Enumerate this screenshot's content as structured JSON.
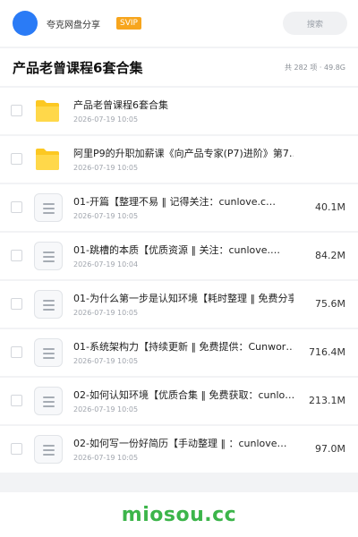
{
  "header": {
    "user_name": "夸克网盘分享",
    "badge": "SVIP",
    "search_label": "搜索"
  },
  "title_bar": {
    "title": "产品老曾课程6套合集",
    "summary": "共 282 项 · 49.8G"
  },
  "files": [
    {
      "name": "产品老曾课程6套合集",
      "date": "2026-07-19 10:05",
      "size": "",
      "type": "folder"
    },
    {
      "name": "阿里P9的升职加薪课《向产品专家(P7)进阶》第7…",
      "date": "2026-07-19 10:05",
      "size": "",
      "type": "folder"
    },
    {
      "name": "01-开篇【整理不易 ‖ 记得关注：cunlove.c…",
      "date": "2026-07-19 10:05",
      "size": "40.1M",
      "type": "file"
    },
    {
      "name": "01-跳槽的本质【优质资源 ‖ 关注：cunlove.…",
      "date": "2026-07-19 10:04",
      "size": "84.2M",
      "type": "file"
    },
    {
      "name": "01-为什么第一步是认知环境【耗时整理 ‖ 免费分享：…",
      "date": "2026-07-19 10:05",
      "size": "75.6M",
      "type": "file"
    },
    {
      "name": "01-系统架构力【持续更新 ‖ 免费提供：Cunwor…",
      "date": "2026-07-19 10:05",
      "size": "716.4M",
      "type": "file"
    },
    {
      "name": "02-如何认知环境【优质合集 ‖ 免费获取：cunlo…",
      "date": "2026-07-19 10:05",
      "size": "213.1M",
      "type": "file"
    },
    {
      "name": "02-如何写一份好简历【手动整理 ‖ ：cunlove…",
      "date": "2026-07-19 10:05",
      "size": "97.0M",
      "type": "file"
    }
  ],
  "watermark": "miosou.cc",
  "colors": {
    "avatar": "#2a7bf6",
    "svip_badge": "#f7a51d",
    "folder": "#fcc822",
    "watermark": "#3cb54a"
  }
}
